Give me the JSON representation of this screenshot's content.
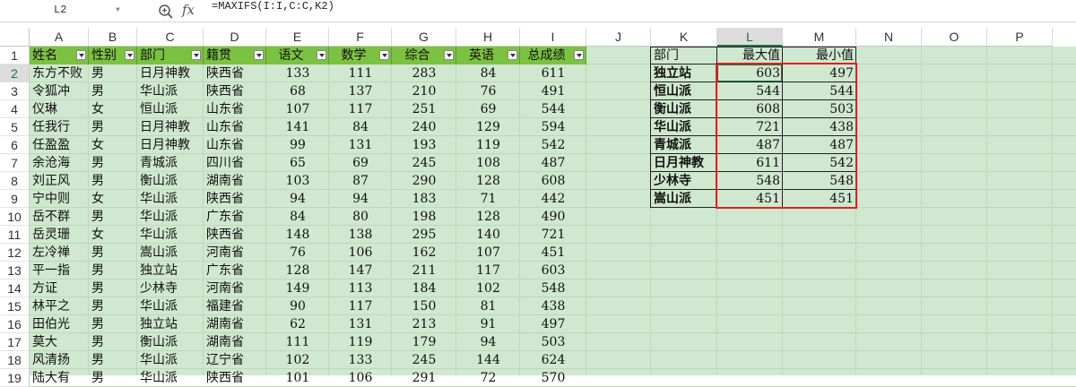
{
  "formula_bar": {
    "name_box": "L2",
    "fx_label": "fx",
    "formula": "=MAXIFS(I:I,C:C,K2)"
  },
  "icons": [
    "zoom-icon",
    "fx-icon",
    "chevron-down-icon"
  ],
  "column_headers": [
    "A",
    "B",
    "C",
    "D",
    "E",
    "F",
    "G",
    "H",
    "I",
    "J",
    "K",
    "L",
    "M",
    "N",
    "O",
    "P"
  ],
  "selected_column": "L",
  "selected_row": 2,
  "row_numbers": [
    "1",
    "2",
    "3",
    "4",
    "5",
    "6",
    "7",
    "8",
    "9",
    "10",
    "11",
    "12",
    "13",
    "14",
    "15",
    "16",
    "17",
    "18",
    "19"
  ],
  "table": {
    "headers": [
      "姓名",
      "性别",
      "部门",
      "籍贯",
      "语文",
      "数学",
      "综合",
      "英语",
      "总成绩"
    ],
    "rows": [
      [
        "东方不败",
        "男",
        "日月神教",
        "陕西省",
        "133",
        "111",
        "283",
        "84",
        "611"
      ],
      [
        "令狐冲",
        "男",
        "华山派",
        "陕西省",
        "68",
        "137",
        "210",
        "76",
        "491"
      ],
      [
        "仪琳",
        "女",
        "恒山派",
        "山东省",
        "107",
        "117",
        "251",
        "69",
        "544"
      ],
      [
        "任我行",
        "男",
        "日月神教",
        "山东省",
        "141",
        "84",
        "240",
        "129",
        "594"
      ],
      [
        "任盈盈",
        "女",
        "日月神教",
        "山东省",
        "99",
        "131",
        "193",
        "119",
        "542"
      ],
      [
        "余沧海",
        "男",
        "青城派",
        "四川省",
        "65",
        "69",
        "245",
        "108",
        "487"
      ],
      [
        "刘正风",
        "男",
        "衡山派",
        "湖南省",
        "103",
        "87",
        "290",
        "128",
        "608"
      ],
      [
        "宁中则",
        "女",
        "华山派",
        "陕西省",
        "94",
        "94",
        "183",
        "71",
        "442"
      ],
      [
        "岳不群",
        "男",
        "华山派",
        "广东省",
        "84",
        "80",
        "198",
        "128",
        "490"
      ],
      [
        "岳灵珊",
        "女",
        "华山派",
        "陕西省",
        "148",
        "138",
        "295",
        "140",
        "721"
      ],
      [
        "左冷禅",
        "男",
        "嵩山派",
        "河南省",
        "76",
        "106",
        "162",
        "107",
        "451"
      ],
      [
        "平一指",
        "男",
        "独立站",
        "广东省",
        "128",
        "147",
        "211",
        "117",
        "603"
      ],
      [
        "方证",
        "男",
        "少林寺",
        "河南省",
        "149",
        "113",
        "184",
        "102",
        "548"
      ],
      [
        "林平之",
        "男",
        "华山派",
        "福建省",
        "90",
        "117",
        "150",
        "81",
        "438"
      ],
      [
        "田伯光",
        "男",
        "独立站",
        "湖南省",
        "62",
        "131",
        "213",
        "91",
        "497"
      ],
      [
        "莫大",
        "男",
        "衡山派",
        "湖南省",
        "111",
        "119",
        "179",
        "94",
        "503"
      ],
      [
        "风清扬",
        "男",
        "华山派",
        "辽宁省",
        "102",
        "133",
        "245",
        "144",
        "624"
      ],
      [
        "陆大有",
        "男",
        "华山派",
        "陕西省",
        "101",
        "106",
        "291",
        "72",
        "570"
      ]
    ]
  },
  "summary": {
    "headers": [
      "部门",
      "最大值",
      "最小值"
    ],
    "rows": [
      [
        "独立站",
        "603",
        "497"
      ],
      [
        "恒山派",
        "544",
        "544"
      ],
      [
        "衡山派",
        "608",
        "503"
      ],
      [
        "华山派",
        "721",
        "438"
      ],
      [
        "青城派",
        "487",
        "487"
      ],
      [
        "日月神教",
        "611",
        "542"
      ],
      [
        "少林寺",
        "548",
        "548"
      ],
      [
        "嵩山派",
        "451",
        "451"
      ]
    ]
  },
  "colors": {
    "sheet_background": "#cfe8cf",
    "header_fill": "#7cc242",
    "highlight_border": "#e02020",
    "selection_accent": "#1e7145"
  }
}
